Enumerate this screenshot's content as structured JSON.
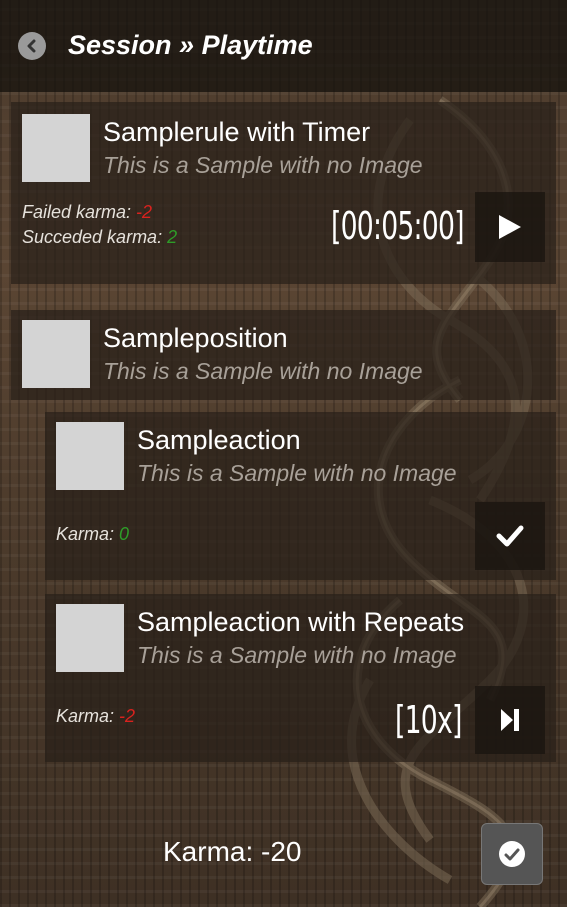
{
  "header": {
    "title": "Session » Playtime"
  },
  "rule_card": {
    "title": "Samplerule with Timer",
    "subtitle": "This is a Sample with no Image",
    "failed_label": "Failed karma: ",
    "failed_value": "-2",
    "succeeded_label": "Succeded karma: ",
    "succeeded_value": "2",
    "timer": "[00:05:00]"
  },
  "position_card": {
    "title": "Sampleposition",
    "subtitle": "This is a Sample with no Image"
  },
  "action_card": {
    "title": "Sampleaction",
    "subtitle": "This is a Sample with no Image",
    "karma_label": "Karma: ",
    "karma_value": "0"
  },
  "repeat_card": {
    "title": "Sampleaction with Repeats",
    "subtitle": "This is a Sample with no Image",
    "karma_label": "Karma: ",
    "karma_value": "-2",
    "repeat_count": "[10x]"
  },
  "footer": {
    "karma_text": "Karma: -20"
  },
  "colors": {
    "negative": "#d8221e",
    "positive": "#2e9c28",
    "thumbnail": "#d4d4d4"
  },
  "icons": {
    "back": "chevron-left-circle-icon",
    "play": "play-icon",
    "done": "check-icon",
    "skip": "skip-forward-icon",
    "confirm": "check-circle-icon"
  }
}
